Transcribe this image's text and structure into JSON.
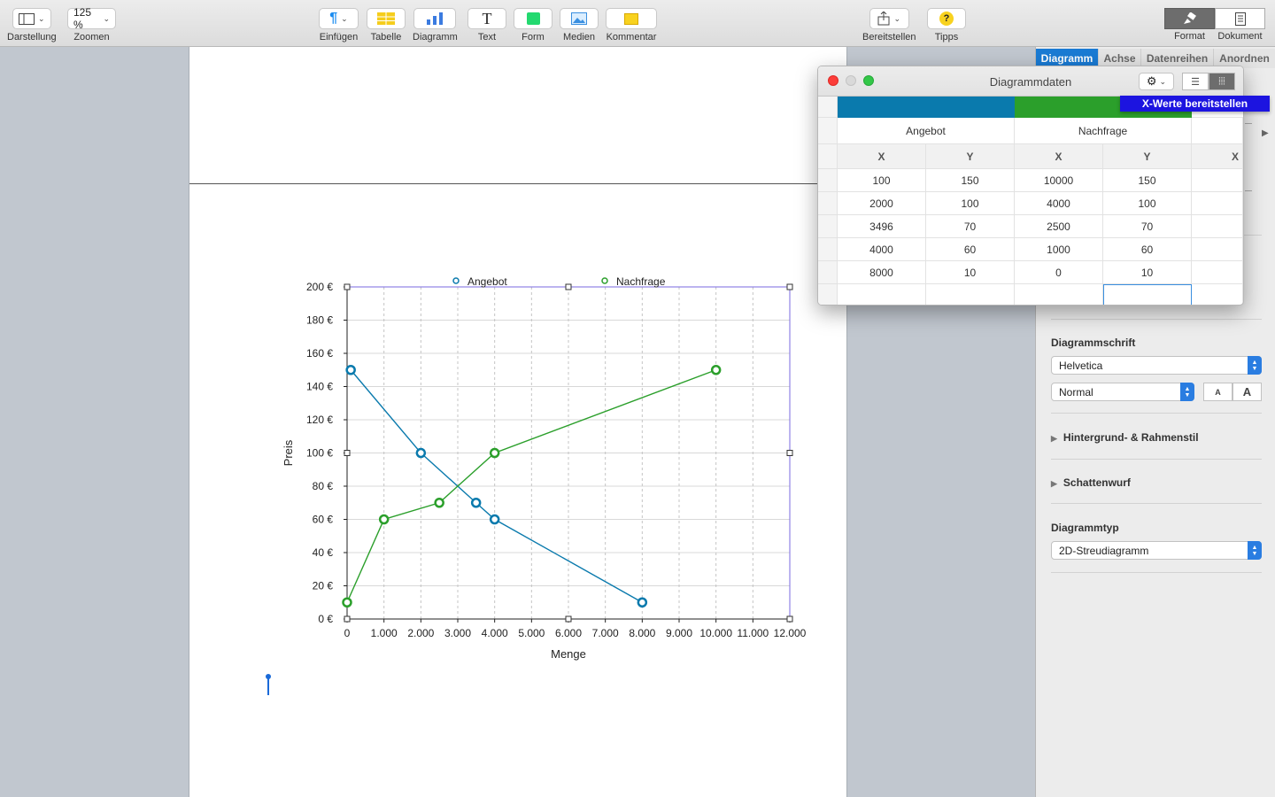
{
  "toolbar": {
    "items": [
      {
        "label": "Darstellung",
        "icon": "sidebar-view-icon"
      },
      {
        "label": "Zoomen",
        "value": "125 %"
      },
      {
        "label": "Einfügen",
        "icon": "paragraph-icon"
      },
      {
        "label": "Tabelle",
        "icon": "table-icon"
      },
      {
        "label": "Diagramm",
        "icon": "chart-icon"
      },
      {
        "label": "Text",
        "icon": "text-icon"
      },
      {
        "label": "Form",
        "icon": "shape-icon"
      },
      {
        "label": "Medien",
        "icon": "media-icon"
      },
      {
        "label": "Kommentar",
        "icon": "comment-icon"
      },
      {
        "label": "Bereitstellen",
        "icon": "share-icon"
      },
      {
        "label": "Tipps",
        "icon": "tips-icon"
      }
    ],
    "format_label": "Format",
    "document_label": "Dokument"
  },
  "sidebar": {
    "tabs": [
      "Diagramm",
      "Achse",
      "Datenreihen",
      "Anordnen"
    ],
    "chart_font_title": "Diagrammschrift",
    "font_family": "Helvetica",
    "font_style": "Normal",
    "font_smaller": "A",
    "font_larger": "A",
    "background_label": "Hintergrund- & Rahmenstil",
    "shadow_label": "Schattenwurf",
    "chart_type_title": "Diagrammtyp",
    "chart_type": "2D-Streudiagramm"
  },
  "dialog": {
    "title": "Diagrammdaten",
    "menu_item": "X-Werte bereitstellen",
    "colors": {
      "angebot": "#0a7aad",
      "nachfrage": "#2b9f2b"
    },
    "series_names": [
      "Angebot",
      "Nachfrage"
    ],
    "col_headers": [
      "X",
      "Y",
      "X",
      "Y",
      "X"
    ],
    "rows": [
      [
        "100",
        "150",
        "10000",
        "150",
        ""
      ],
      [
        "2000",
        "100",
        "4000",
        "100",
        ""
      ],
      [
        "3496",
        "70",
        "2500",
        "70",
        ""
      ],
      [
        "4000",
        "60",
        "1000",
        "60",
        ""
      ],
      [
        "8000",
        "10",
        "0",
        "10",
        ""
      ]
    ]
  },
  "chart_data": {
    "type": "scatter",
    "xlabel": "Menge",
    "ylabel": "Preis",
    "xlim": [
      0,
      12000
    ],
    "ylim": [
      0,
      200
    ],
    "xticks": [
      "0",
      "1.000",
      "2.000",
      "3.000",
      "4.000",
      "5.000",
      "6.000",
      "7.000",
      "8.000",
      "9.000",
      "10.000",
      "11.000",
      "12.000"
    ],
    "yticks": [
      "0 €",
      "20 €",
      "40 €",
      "60 €",
      "80 €",
      "100 €",
      "120 €",
      "140 €",
      "160 €",
      "180 €",
      "200 €"
    ],
    "legend_position": "top",
    "grid": true,
    "series": [
      {
        "name": "Angebot",
        "color": "#0a7aad",
        "points": [
          [
            100,
            150
          ],
          [
            2000,
            100
          ],
          [
            3496,
            70
          ],
          [
            4000,
            60
          ],
          [
            8000,
            10
          ]
        ]
      },
      {
        "name": "Nachfrage",
        "color": "#2b9f2b",
        "points": [
          [
            0,
            10
          ],
          [
            1000,
            60
          ],
          [
            2500,
            70
          ],
          [
            4000,
            100
          ],
          [
            10000,
            150
          ]
        ]
      }
    ]
  }
}
